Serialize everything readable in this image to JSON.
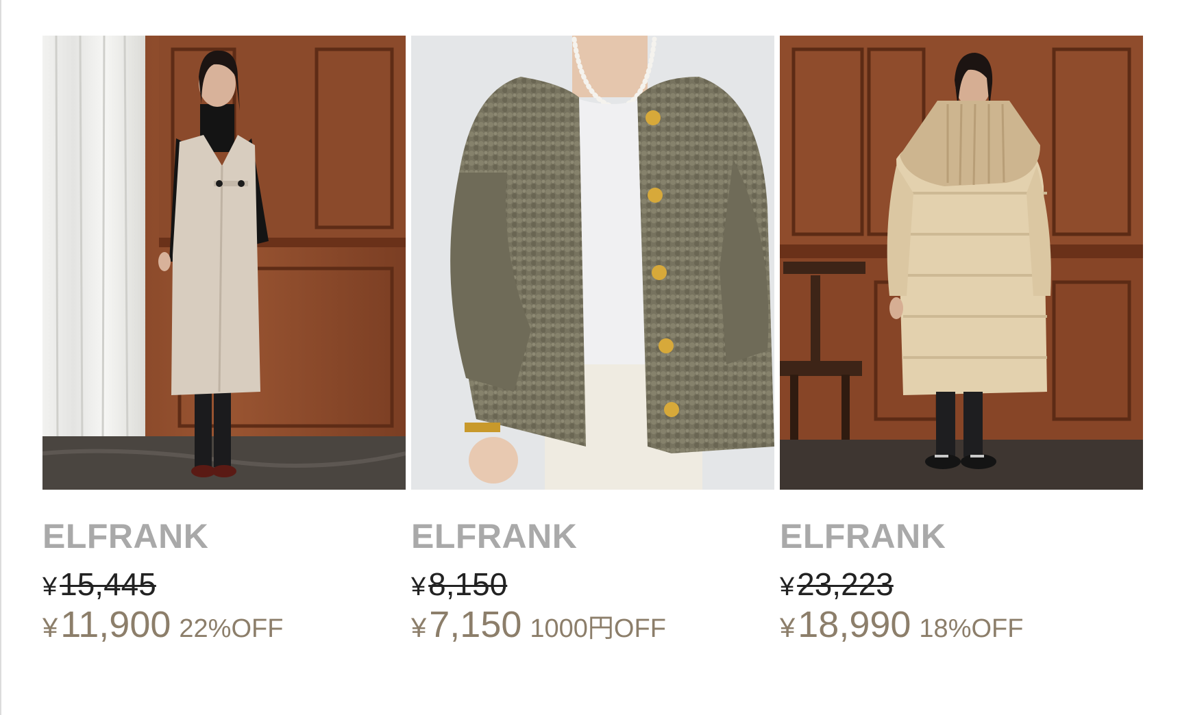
{
  "products": [
    {
      "brand": "ELFRANK",
      "currency": "¥",
      "original_price": "15,445",
      "sale_price": "11,900",
      "discount": "22%OFF",
      "image": "model-in-beige-wrap-vest-dress"
    },
    {
      "brand": "ELFRANK",
      "currency": "¥",
      "original_price": "8,150",
      "sale_price": "7,150",
      "discount": "1000円OFF",
      "image": "khaki-boucle-cardigan-jacket"
    },
    {
      "brand": "ELFRANK",
      "currency": "¥",
      "original_price": "23,223",
      "sale_price": "18,990",
      "discount": "18%OFF",
      "image": "model-in-beige-down-coat-with-knit-collar"
    }
  ],
  "colors": {
    "brand_text": "#a9a9a9",
    "original_price_text": "#222222",
    "sale_price_text": "#8c7e6a"
  }
}
